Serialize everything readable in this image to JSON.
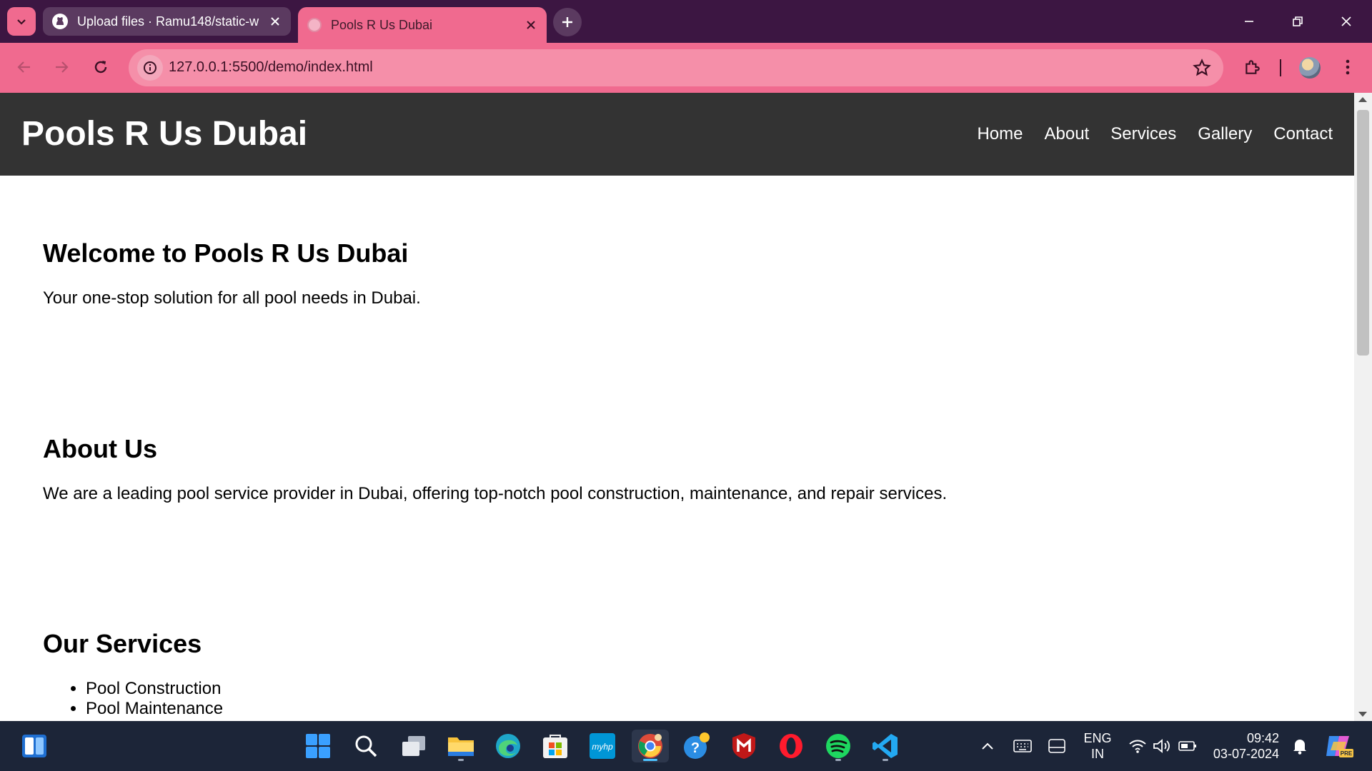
{
  "browser": {
    "tabs": [
      {
        "title": "Upload files · Ramu148/static-w",
        "icon": "github-icon",
        "active": false
      },
      {
        "title": "Pools R Us Dubai",
        "icon": "globe-icon",
        "active": true
      }
    ],
    "url": "127.0.0.1:5500/demo/index.html",
    "theme_color": "#f06a8f",
    "frame_color": "#3c1642"
  },
  "site": {
    "title": "Pools R Us Dubai",
    "nav": [
      "Home",
      "About",
      "Services",
      "Gallery",
      "Contact"
    ],
    "header_color": "#333333"
  },
  "sections": {
    "welcome": {
      "heading": "Welcome to Pools R Us Dubai",
      "text": "Your one-stop solution for all pool needs in Dubai."
    },
    "about": {
      "heading": "About Us",
      "text": "We are a leading pool service provider in Dubai, offering top-notch pool construction, maintenance, and repair services."
    },
    "services": {
      "heading": "Our Services",
      "items": [
        "Pool Construction",
        "Pool Maintenance"
      ]
    }
  },
  "taskbar": {
    "apps": [
      "start-icon",
      "search-icon",
      "task-view-icon",
      "file-explorer-icon",
      "edge-icon",
      "store-icon",
      "myhp-icon",
      "chrome-icon",
      "help-icon",
      "mcafee-icon",
      "opera-icon",
      "spotify-icon",
      "vscode-icon"
    ],
    "myhp_label": "myhp",
    "language": {
      "line1": "ENG",
      "line2": "IN"
    },
    "clock": {
      "time": "09:42",
      "date": "03-07-2024"
    },
    "copilot_badge": "PRE"
  }
}
